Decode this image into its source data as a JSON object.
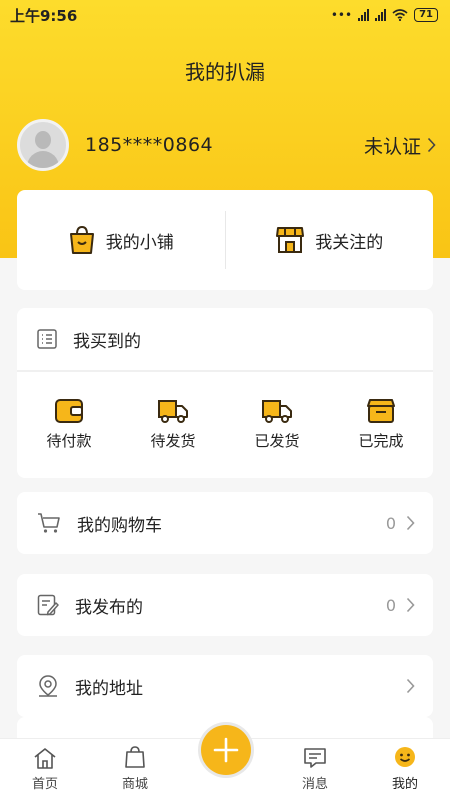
{
  "status": {
    "time": "上午9:56",
    "battery": "71"
  },
  "header": {
    "title": "我的扒漏"
  },
  "profile": {
    "phone": "185****0864",
    "verify_label": "未认证"
  },
  "shop": {
    "my_shop": "我的小铺",
    "my_follow": "我关注的"
  },
  "bought": {
    "title": "我买到的",
    "orders": [
      {
        "label": "待付款",
        "icon": "wallet-icon"
      },
      {
        "label": "待发货",
        "icon": "truck-icon"
      },
      {
        "label": "已发货",
        "icon": "truck-icon"
      },
      {
        "label": "已完成",
        "icon": "box-icon"
      }
    ]
  },
  "menu": {
    "cart": {
      "label": "我的购物车",
      "count": "0"
    },
    "published": {
      "label": "我发布的",
      "count": "0"
    },
    "address": {
      "label": "我的地址"
    }
  },
  "tabbar": {
    "home": "首页",
    "mall": "商城",
    "messages": "消息",
    "mine": "我的"
  },
  "colors": {
    "brand": "#fddc2c",
    "accent": "#f6b61a",
    "icon_fill": "#f6b61a"
  }
}
